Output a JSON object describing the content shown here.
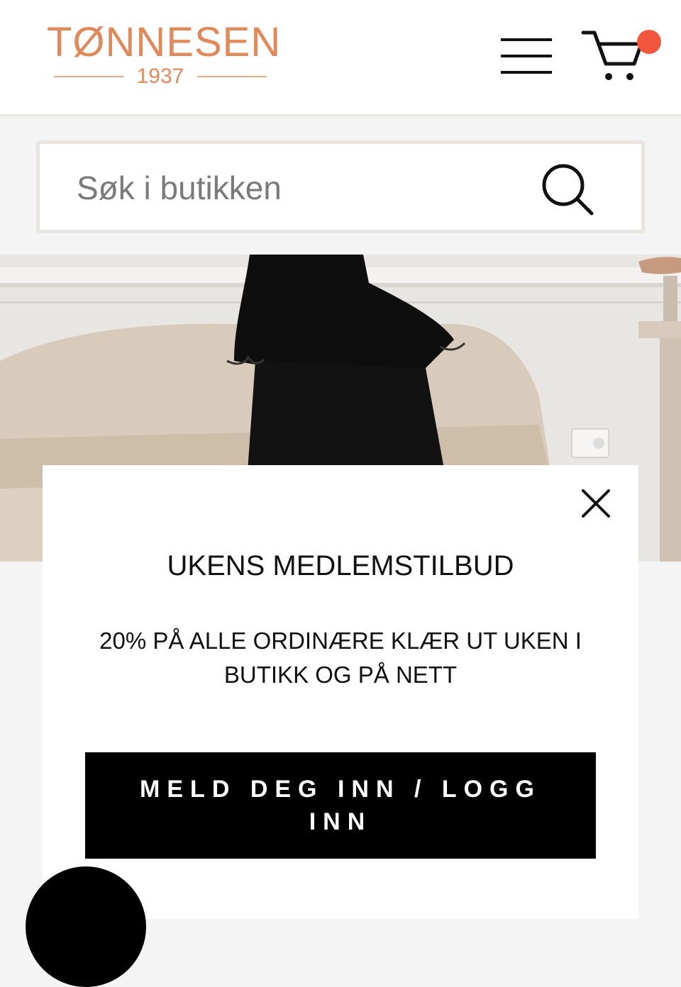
{
  "header": {
    "logo": {
      "name": "TØNNESEN",
      "year": "1937"
    },
    "menu_icon": "hamburger-menu-icon",
    "cart_icon": "shopping-cart-icon",
    "cart_badge_color": "#f2563c",
    "brand_color": "#e0895a"
  },
  "search": {
    "placeholder": "Søk i butikken",
    "icon": "search-icon"
  },
  "hero": {
    "image": "woman-in-black-pleated-dress-photo"
  },
  "modal": {
    "close_icon": "close-icon",
    "title": "UKENS MEDLEMSTILBUD",
    "text": "20% PÅ ALLE ORDINÆRE KLÆR UT UKEN I BUTIKK OG PÅ NETT",
    "cta_label": "MELD DEG INN / LOGG INN"
  },
  "chat": {
    "icon": "chat-bubble-icon"
  }
}
